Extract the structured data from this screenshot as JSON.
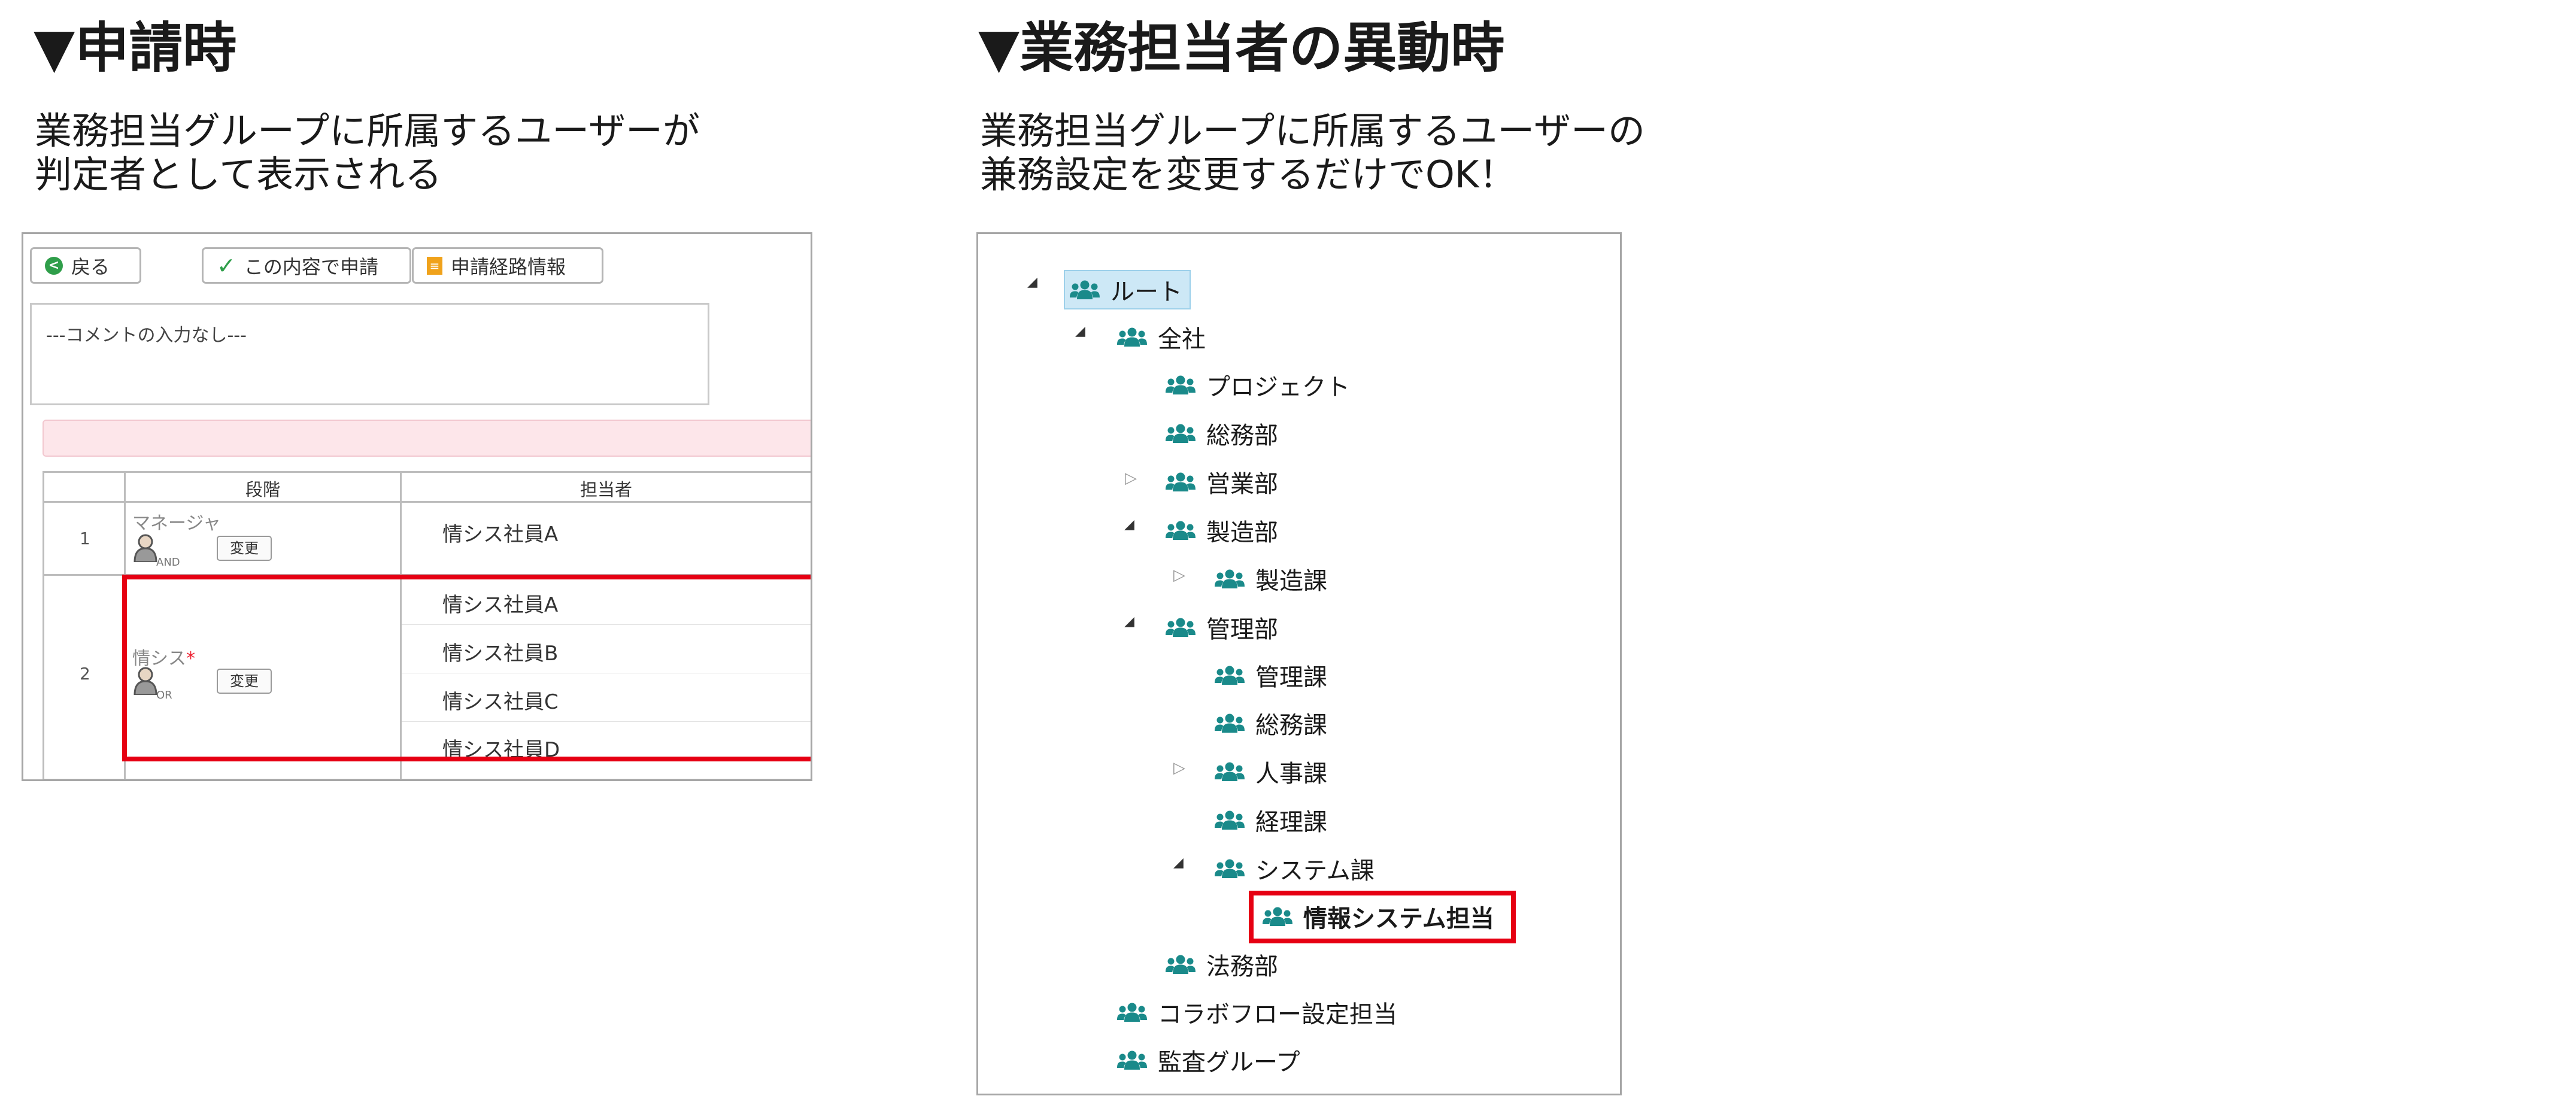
{
  "left": {
    "heading": "▼申請時",
    "desc_lines": [
      "業務担当グループに所属するユーザーが",
      "判定者として表示される"
    ],
    "toolbar": {
      "back": "戻る",
      "apply": "この内容で申請",
      "route_info": "申請経路情報"
    },
    "comment_placeholder": "---コメントの入力なし---",
    "table": {
      "headers": [
        "段階",
        "担当者"
      ],
      "rows": [
        {
          "num": "1",
          "stage": "マネージャ",
          "badge": "AND",
          "change": "変更",
          "assignees": [
            "情シス社員A"
          ]
        },
        {
          "num": "2",
          "stage": "情シス",
          "required_mark": "*",
          "badge": "OR",
          "change": "変更",
          "assignees": [
            "情シス社員A",
            "情シス社員B",
            "情シス社員C",
            "情シス社員D"
          ]
        }
      ]
    }
  },
  "right": {
    "heading": "▼業務担当者の異動時",
    "desc_lines": [
      "業務担当グループに所属するユーザーの",
      "兼務設定を変更するだけでOK！"
    ],
    "tree": [
      {
        "label": "ルート",
        "state": "expanded",
        "highlight": "selected"
      },
      {
        "label": "全社",
        "state": "expanded"
      },
      {
        "label": "プロジェクト",
        "state": "leaf"
      },
      {
        "label": "総務部",
        "state": "leaf"
      },
      {
        "label": "営業部",
        "state": "collapsed"
      },
      {
        "label": "製造部",
        "state": "expanded"
      },
      {
        "label": "製造課",
        "state": "collapsed"
      },
      {
        "label": "管理部",
        "state": "expanded"
      },
      {
        "label": "管理課",
        "state": "leaf"
      },
      {
        "label": "総務課",
        "state": "leaf"
      },
      {
        "label": "人事課",
        "state": "collapsed"
      },
      {
        "label": "経理課",
        "state": "leaf"
      },
      {
        "label": "システム課",
        "state": "expanded"
      },
      {
        "label": "情報システム担当",
        "state": "leaf",
        "highlight": "red-frame"
      },
      {
        "label": "法務部",
        "state": "leaf"
      },
      {
        "label": "コラボフロー設定担当",
        "state": "leaf"
      },
      {
        "label": "監査グループ",
        "state": "leaf"
      }
    ]
  },
  "colors": {
    "accent_red": "#e60012",
    "group_icon": "#1a8a8a",
    "selected_bg": "#cde8f6",
    "success_green": "#2f9e4a",
    "route_orange": "#f0a21b"
  }
}
